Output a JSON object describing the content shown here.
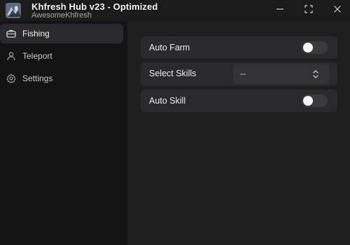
{
  "app": {
    "title": "Khfresh Hub v23 - Optimized",
    "subtitle": "AwesomeKhfresh"
  },
  "window_controls": {
    "minimize_icon": "minimize-icon",
    "maximize_icon": "maximize-icon",
    "close_icon": "close-icon"
  },
  "sidebar": {
    "items": [
      {
        "label": "Fishing",
        "icon": "tackle-box-icon",
        "active": true
      },
      {
        "label": "Teleport",
        "icon": "person-icon",
        "active": false
      },
      {
        "label": "Settings",
        "icon": "gear-icon",
        "active": false
      }
    ]
  },
  "main": {
    "auto_farm": {
      "label": "Auto Farm",
      "enabled": false
    },
    "select_skills": {
      "label": "Select Skills",
      "value": "--"
    },
    "auto_skill": {
      "label": "Auto Skill",
      "enabled": false
    }
  },
  "colors": {
    "background": "#1b1b1c",
    "sidebar": "#141415",
    "panel": "#1e1e1f",
    "row": "#2a2a2c",
    "toggle_off": "#3a3a3d",
    "text": "#ececee"
  }
}
